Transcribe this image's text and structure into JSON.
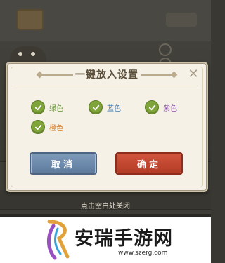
{
  "dialog": {
    "title": "一键放入设置",
    "close_symbol": "✕",
    "options": [
      {
        "label": "绿色",
        "checked": true,
        "color": "#5e8e2c"
      },
      {
        "label": "蓝色",
        "checked": true,
        "color": "#3c78b0"
      },
      {
        "label": "紫色",
        "checked": true,
        "color": "#8a4db2"
      },
      {
        "label": "橙色",
        "checked": true,
        "color": "#d07a25"
      }
    ],
    "cancel_label": "取消",
    "confirm_label": "确定"
  },
  "overlay": {
    "close_hint": "点击空白处关闭"
  },
  "banner": {
    "site_name": "安瑞手游网",
    "url": "www.szerg.com"
  },
  "colors": {
    "check_green": "#7fa43a",
    "cancel_blue": "#6a86a8",
    "confirm_red": "#c2452f"
  }
}
